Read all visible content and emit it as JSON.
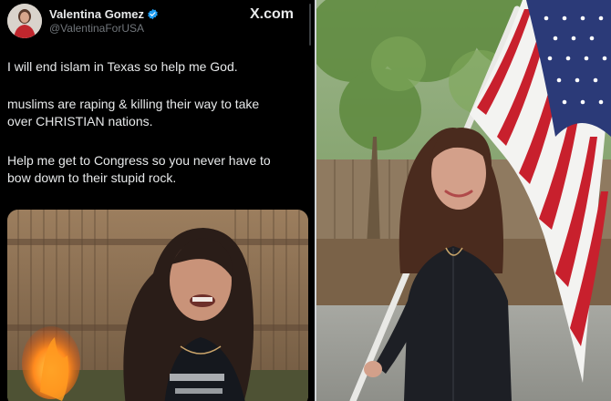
{
  "tweet": {
    "display_name": "Valentina Gomez",
    "handle": "@ValentinaForUSA",
    "site_label": "X.com",
    "lines": [
      "I will end islam in Texas so help me God.",
      "muslims are raping & killing their way to take",
      "over CHRISTIAN nations.",
      "Help me get to Congress so you never have to",
      "bow down to their stupid rock."
    ],
    "icons": {
      "verified": "verified-badge-icon",
      "logo": "x-logo-icon"
    },
    "colors": {
      "background": "#000000",
      "text": "#e7e9ea",
      "handle": "#71767b",
      "verified": "#1d9bf0"
    }
  }
}
